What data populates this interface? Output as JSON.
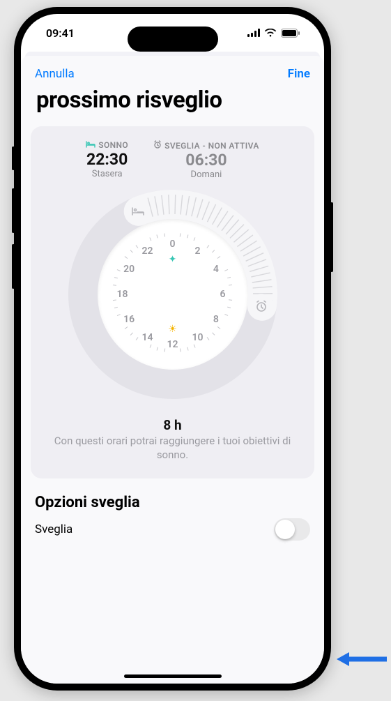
{
  "status": {
    "time": "09:41"
  },
  "sheet": {
    "cancel": "Annulla",
    "done": "Fine",
    "title": "prossimo risveglio"
  },
  "sleep": {
    "label": "SONNO",
    "time": "22:30",
    "sub": "Stasera"
  },
  "wake": {
    "label": "SVEGLIA - NON ATTIVA",
    "time": "06:30",
    "sub": "Domani"
  },
  "dial": {
    "hours": [
      "0",
      "2",
      "4",
      "6",
      "8",
      "10",
      "12",
      "14",
      "16",
      "18",
      "20",
      "22"
    ],
    "start_hour": 22.5,
    "end_hour": 6.5
  },
  "duration": {
    "value": "8 h",
    "text": "Con questi orari potrai raggiungere i tuoi obiettivi di sonno."
  },
  "options": {
    "title": "Opzioni sveglia",
    "alarm_label": "Sveglia",
    "alarm_on": false
  }
}
